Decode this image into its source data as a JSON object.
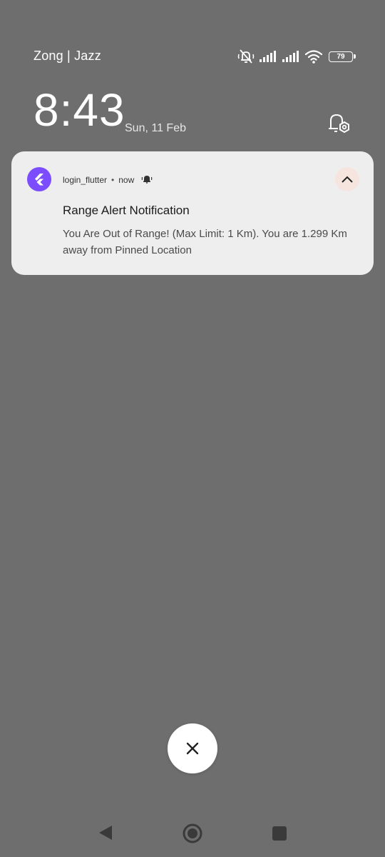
{
  "status_bar": {
    "carrier": "Zong | Jazz",
    "battery_level": "79",
    "icons": [
      "mute-vibrate-off-icon",
      "signal-sim1-icon",
      "signal-sim2-icon",
      "wifi-icon",
      "battery-icon"
    ]
  },
  "lockscreen": {
    "time": "8:43",
    "date": "Sun, 11 Feb"
  },
  "notification": {
    "app_name": "login_flutter",
    "separator": "•",
    "time": "now",
    "title": "Range Alert Notification",
    "body": "You Are Out of Range! (Max Limit: 1 Km). You are 1.299 Km away from Pinned Location",
    "app_icon": "flutter-icon",
    "accent_color": "#7c4dff"
  },
  "controls": {
    "dismiss_icon": "close-icon"
  },
  "nav": {
    "icons": [
      "back-icon",
      "home-icon",
      "recents-icon"
    ]
  }
}
